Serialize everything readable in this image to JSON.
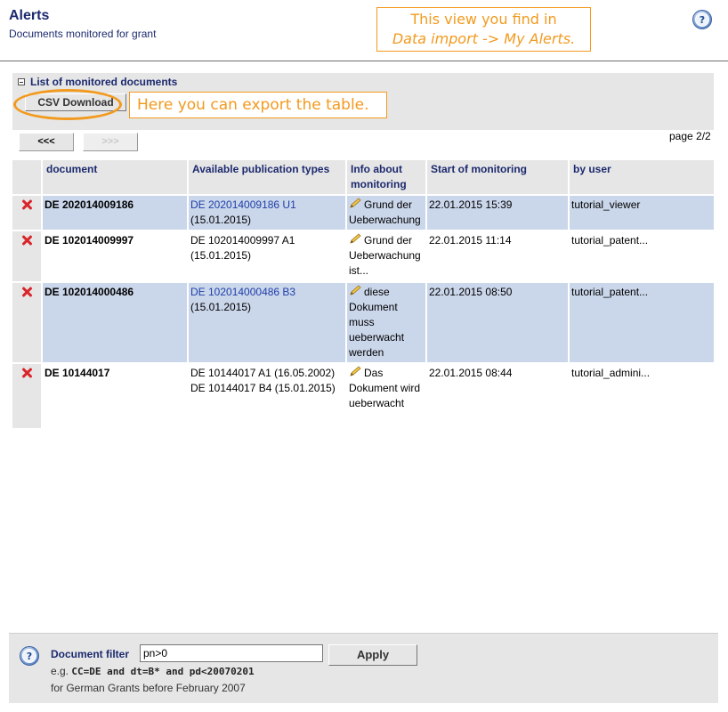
{
  "header": {
    "title": "Alerts",
    "subtitle": "Documents monitored for grant"
  },
  "annotations": {
    "top_line1": "This view you find in",
    "top_line2": "Data import -> My Alerts.",
    "export_hint": "Here you can export the table."
  },
  "list": {
    "title": "List of monitored documents",
    "csv_label": "CSV Download",
    "prev_label": "<<<",
    "next_label": ">>>",
    "page": "page 2/2"
  },
  "table": {
    "headers": [
      "document",
      "Available publication types",
      "Info about monitoring",
      "Start of monitoring",
      "by user"
    ],
    "rows": [
      {
        "document": "DE 202014009186",
        "pub1": "DE 202014009186 U1",
        "pub1_link": true,
        "pub2": "(15.01.2015)",
        "info": "Grund der Ueberwachung",
        "start": "22.01.2015 15:39",
        "user": "tutorial_viewer",
        "highlight": true
      },
      {
        "document": "DE 102014009997",
        "pub1": "DE 102014009997 A1",
        "pub1_link": false,
        "pub2": "(15.01.2015)",
        "info": "Grund der Ueberwachung ist...",
        "start": "22.01.2015 11:14",
        "user": "tutorial_patent...",
        "highlight": false
      },
      {
        "document": "DE 102014000486",
        "pub1": "DE 102014000486 B3",
        "pub1_link": true,
        "pub2": "(15.01.2015)",
        "info": "diese Dokument muss ueberwacht werden",
        "start": "22.01.2015 08:50",
        "user": "tutorial_patent...",
        "highlight": true
      },
      {
        "document": "DE 10144017",
        "pub1": "DE 10144017 A1 (16.05.2002)",
        "pub1_link": false,
        "pub2": "DE 10144017 B4 (15.01.2015)",
        "info": "Das Dokument wird ueberwacht",
        "start": "22.01.2015 08:44",
        "user": "tutorial_admini...",
        "highlight": false
      }
    ]
  },
  "filter": {
    "label": "Document filter",
    "value": "pn>0",
    "apply_label": "Apply",
    "hint_prefix": "e.g.",
    "hint_code": "CC=DE and dt=B* and pd<20070201",
    "hint_line2": "for German Grants before February 2007"
  },
  "colors": {
    "accent": "#1c2a6e",
    "annotation": "#f29a1f",
    "row_highlight": "#cad6ea",
    "delete": "#d8262b"
  }
}
